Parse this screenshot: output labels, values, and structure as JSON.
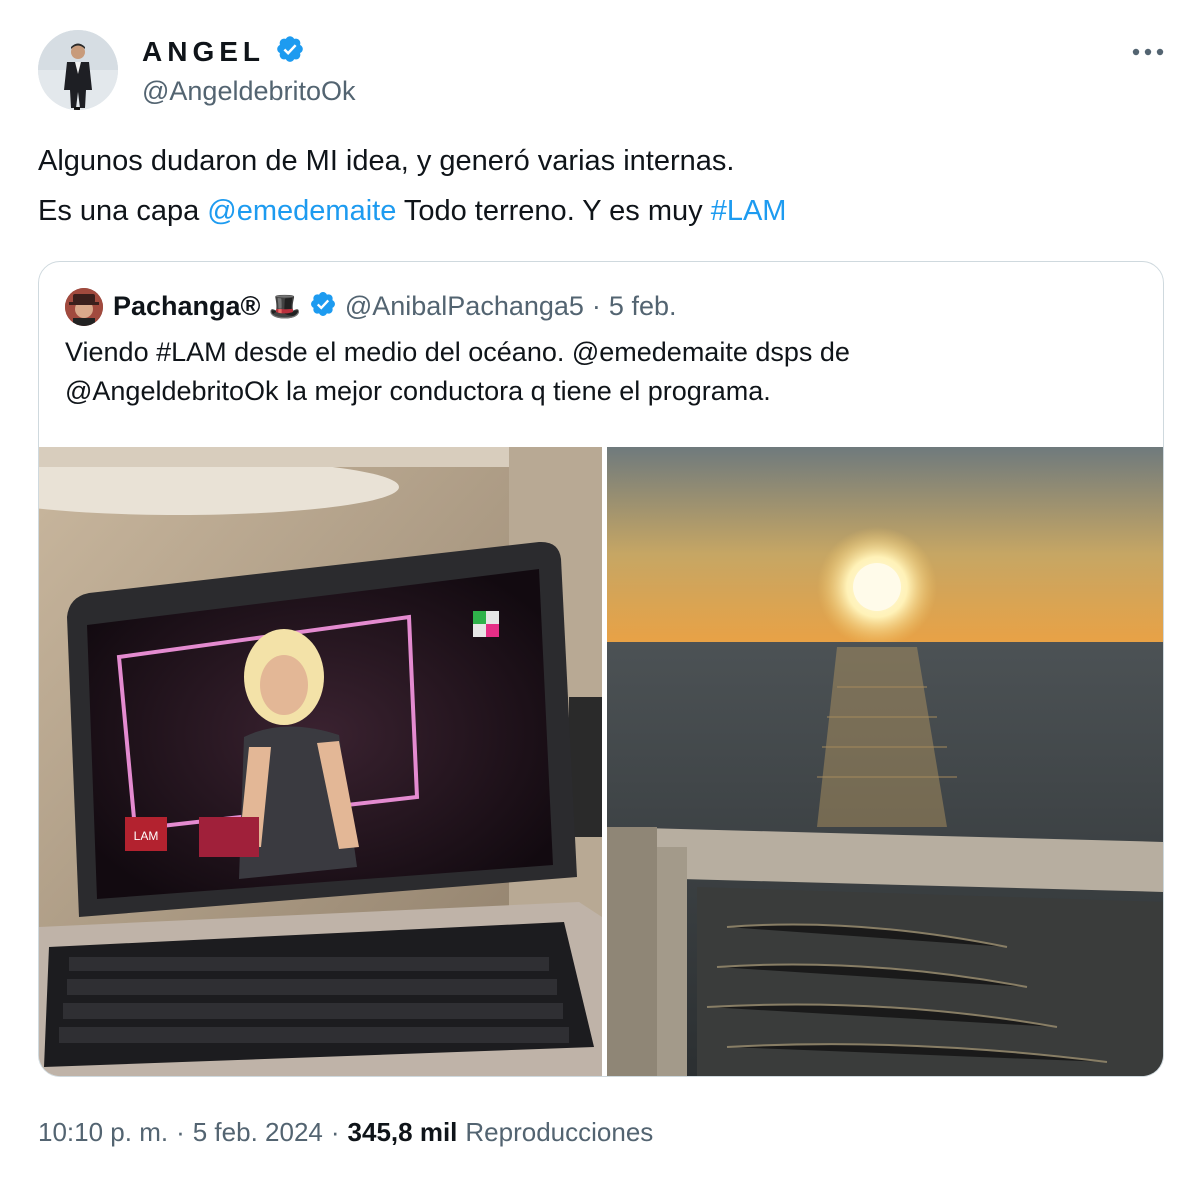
{
  "author": {
    "name": "ANGEL",
    "handle": "@AngeldebritoOk",
    "verified_icon": "verified-badge-icon",
    "accent": "#1d9bf0"
  },
  "tweet_text": {
    "line1": "Algunos dudaron de MI idea, y generó varias internas.",
    "line2_prefix": "Es una capa ",
    "mention": "@emedemaite",
    "line2_middle": " Todo terreno. Y es muy ",
    "hashtag": "#LAM"
  },
  "quoted": {
    "name": "Pachanga®",
    "emoji": "🎩",
    "handle": "@AnibalPachanga5",
    "dot": "·",
    "date": "5 feb.",
    "line1": "Viendo #LAM desde el medio del océano.  @emedemaite dsps de",
    "line2": "@AngeldebritoOk la mejor conductora q tiene el programa.",
    "images": [
      "laptop-showing-lam-broadcast",
      "sunset-over-ocean-from-ship"
    ]
  },
  "footer": {
    "time": "10:10 p. m.",
    "dot1": "·",
    "date": "5 feb. 2024",
    "dot2": "·",
    "views": "345,8 mil",
    "views_label": "Reproducciones"
  }
}
